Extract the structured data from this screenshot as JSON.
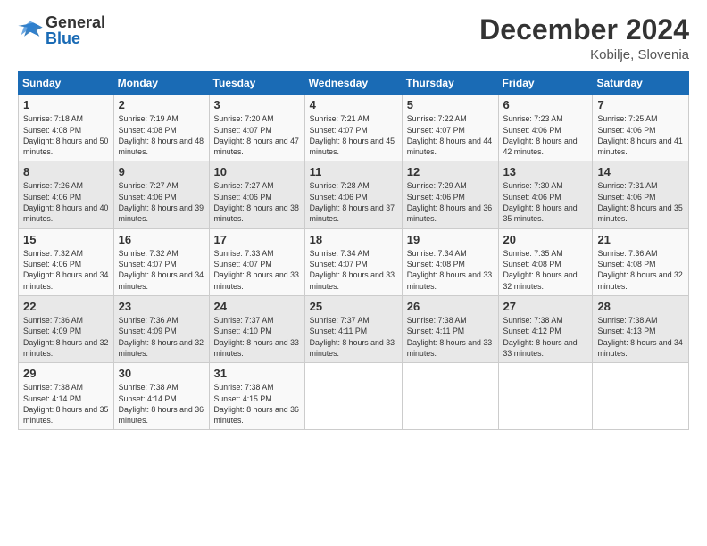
{
  "header": {
    "logo_general": "General",
    "logo_blue": "Blue",
    "month_title": "December 2024",
    "location": "Kobilje, Slovenia"
  },
  "days_of_week": [
    "Sunday",
    "Monday",
    "Tuesday",
    "Wednesday",
    "Thursday",
    "Friday",
    "Saturday"
  ],
  "weeks": [
    [
      {
        "day": "1",
        "sunrise": "7:18 AM",
        "sunset": "4:08 PM",
        "daylight": "8 hours and 50 minutes."
      },
      {
        "day": "2",
        "sunrise": "7:19 AM",
        "sunset": "4:08 PM",
        "daylight": "8 hours and 48 minutes."
      },
      {
        "day": "3",
        "sunrise": "7:20 AM",
        "sunset": "4:07 PM",
        "daylight": "8 hours and 47 minutes."
      },
      {
        "day": "4",
        "sunrise": "7:21 AM",
        "sunset": "4:07 PM",
        "daylight": "8 hours and 45 minutes."
      },
      {
        "day": "5",
        "sunrise": "7:22 AM",
        "sunset": "4:07 PM",
        "daylight": "8 hours and 44 minutes."
      },
      {
        "day": "6",
        "sunrise": "7:23 AM",
        "sunset": "4:06 PM",
        "daylight": "8 hours and 42 minutes."
      },
      {
        "day": "7",
        "sunrise": "7:25 AM",
        "sunset": "4:06 PM",
        "daylight": "8 hours and 41 minutes."
      }
    ],
    [
      {
        "day": "8",
        "sunrise": "7:26 AM",
        "sunset": "4:06 PM",
        "daylight": "8 hours and 40 minutes."
      },
      {
        "day": "9",
        "sunrise": "7:27 AM",
        "sunset": "4:06 PM",
        "daylight": "8 hours and 39 minutes."
      },
      {
        "day": "10",
        "sunrise": "7:27 AM",
        "sunset": "4:06 PM",
        "daylight": "8 hours and 38 minutes."
      },
      {
        "day": "11",
        "sunrise": "7:28 AM",
        "sunset": "4:06 PM",
        "daylight": "8 hours and 37 minutes."
      },
      {
        "day": "12",
        "sunrise": "7:29 AM",
        "sunset": "4:06 PM",
        "daylight": "8 hours and 36 minutes."
      },
      {
        "day": "13",
        "sunrise": "7:30 AM",
        "sunset": "4:06 PM",
        "daylight": "8 hours and 35 minutes."
      },
      {
        "day": "14",
        "sunrise": "7:31 AM",
        "sunset": "4:06 PM",
        "daylight": "8 hours and 35 minutes."
      }
    ],
    [
      {
        "day": "15",
        "sunrise": "7:32 AM",
        "sunset": "4:06 PM",
        "daylight": "8 hours and 34 minutes."
      },
      {
        "day": "16",
        "sunrise": "7:32 AM",
        "sunset": "4:07 PM",
        "daylight": "8 hours and 34 minutes."
      },
      {
        "day": "17",
        "sunrise": "7:33 AM",
        "sunset": "4:07 PM",
        "daylight": "8 hours and 33 minutes."
      },
      {
        "day": "18",
        "sunrise": "7:34 AM",
        "sunset": "4:07 PM",
        "daylight": "8 hours and 33 minutes."
      },
      {
        "day": "19",
        "sunrise": "7:34 AM",
        "sunset": "4:08 PM",
        "daylight": "8 hours and 33 minutes."
      },
      {
        "day": "20",
        "sunrise": "7:35 AM",
        "sunset": "4:08 PM",
        "daylight": "8 hours and 32 minutes."
      },
      {
        "day": "21",
        "sunrise": "7:36 AM",
        "sunset": "4:08 PM",
        "daylight": "8 hours and 32 minutes."
      }
    ],
    [
      {
        "day": "22",
        "sunrise": "7:36 AM",
        "sunset": "4:09 PM",
        "daylight": "8 hours and 32 minutes."
      },
      {
        "day": "23",
        "sunrise": "7:36 AM",
        "sunset": "4:09 PM",
        "daylight": "8 hours and 32 minutes."
      },
      {
        "day": "24",
        "sunrise": "7:37 AM",
        "sunset": "4:10 PM",
        "daylight": "8 hours and 33 minutes."
      },
      {
        "day": "25",
        "sunrise": "7:37 AM",
        "sunset": "4:11 PM",
        "daylight": "8 hours and 33 minutes."
      },
      {
        "day": "26",
        "sunrise": "7:38 AM",
        "sunset": "4:11 PM",
        "daylight": "8 hours and 33 minutes."
      },
      {
        "day": "27",
        "sunrise": "7:38 AM",
        "sunset": "4:12 PM",
        "daylight": "8 hours and 33 minutes."
      },
      {
        "day": "28",
        "sunrise": "7:38 AM",
        "sunset": "4:13 PM",
        "daylight": "8 hours and 34 minutes."
      }
    ],
    [
      {
        "day": "29",
        "sunrise": "7:38 AM",
        "sunset": "4:14 PM",
        "daylight": "8 hours and 35 minutes."
      },
      {
        "day": "30",
        "sunrise": "7:38 AM",
        "sunset": "4:14 PM",
        "daylight": "8 hours and 36 minutes."
      },
      {
        "day": "31",
        "sunrise": "7:38 AM",
        "sunset": "4:15 PM",
        "daylight": "8 hours and 36 minutes."
      },
      null,
      null,
      null,
      null
    ]
  ]
}
